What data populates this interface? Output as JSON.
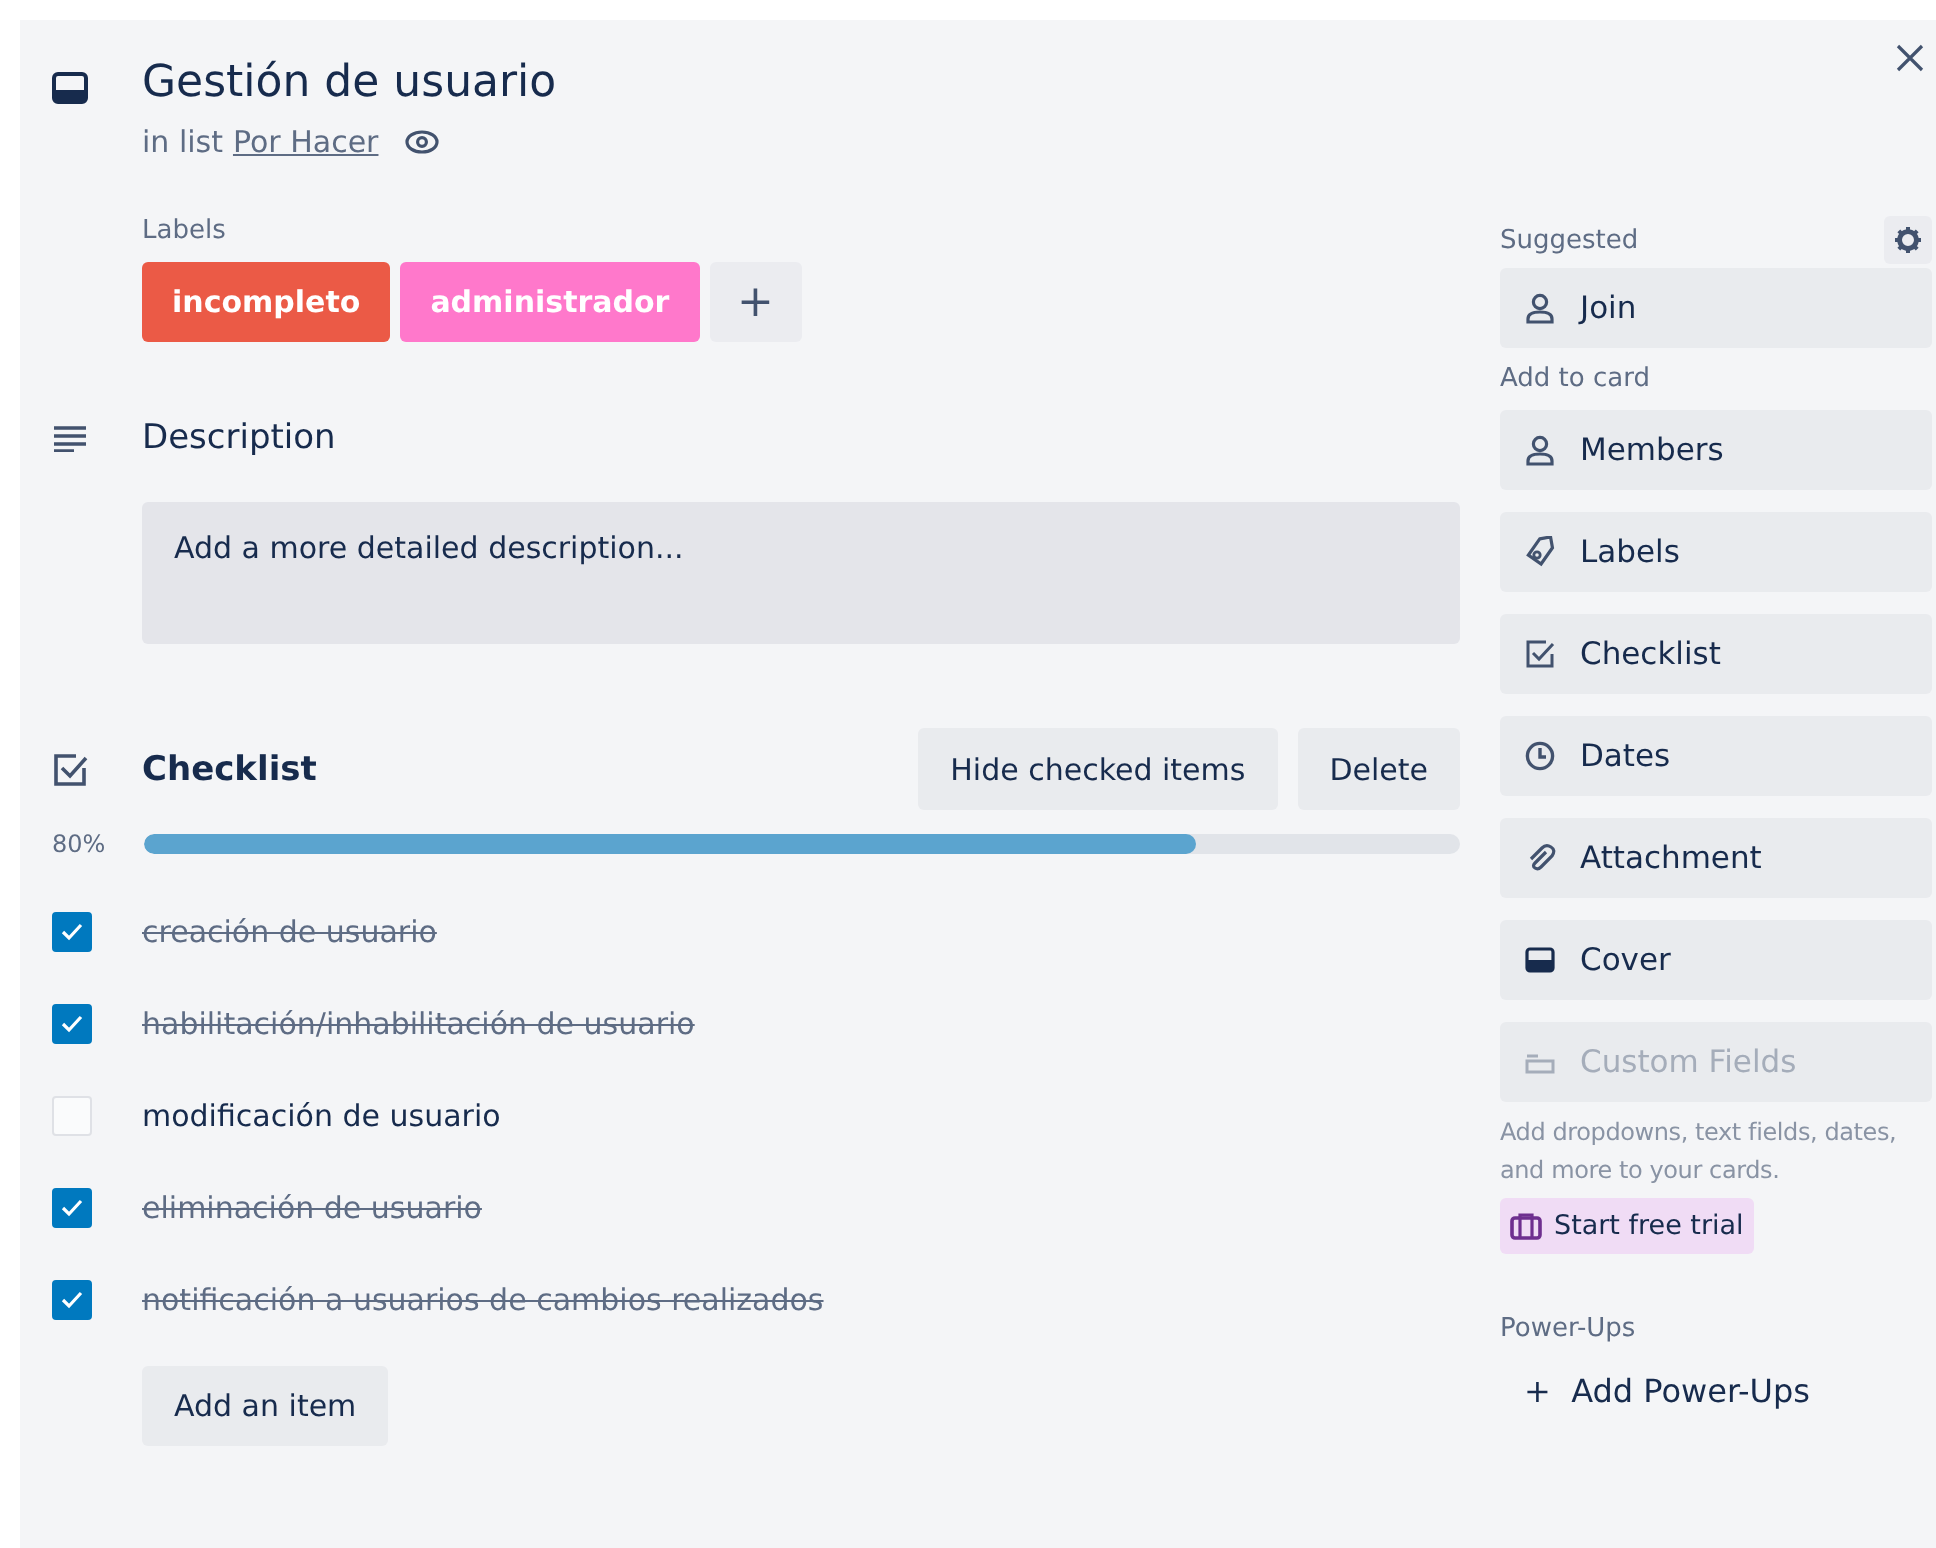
{
  "card": {
    "title": "Gestión de usuario",
    "list_prefix": "in list",
    "list_name": "Por Hacer"
  },
  "labels": {
    "heading": "Labels",
    "items": [
      {
        "text": "incompleto",
        "color": "#eb5a46"
      },
      {
        "text": "administrador",
        "color": "#ff78cb"
      }
    ],
    "add": "+"
  },
  "description": {
    "heading": "Description",
    "placeholder": "Add a more detailed description..."
  },
  "checklist": {
    "heading": "Checklist",
    "buttons": [
      "Hide checked items",
      "Delete"
    ],
    "percent": "80%",
    "level": 0.8,
    "items": [
      {
        "text": "creación de usuario",
        "checked": true
      },
      {
        "text": "habilitación/inhabilitación de usuario",
        "checked": true
      },
      {
        "text": "modificación de usuario",
        "checked": false
      },
      {
        "text": "eliminación de usuario",
        "checked": true
      },
      {
        "text": "notificación a usuarios de cambios realizados",
        "checked": true
      }
    ],
    "add_item": "Add an item"
  },
  "sidebar": {
    "suggested": {
      "heading": "Suggested",
      "items": [
        {
          "text": "Join",
          "disabled": false
        }
      ]
    },
    "add_to_card": {
      "heading": "Add to card",
      "items": [
        {
          "text": "Members",
          "disabled": false
        },
        {
          "text": "Labels",
          "disabled": false
        },
        {
          "text": "Checklist",
          "disabled": false
        },
        {
          "text": "Dates",
          "disabled": false
        },
        {
          "text": "Attachment",
          "disabled": false
        },
        {
          "text": "Cover",
          "disabled": false
        },
        {
          "text": "Custom Fields",
          "disabled": true
        }
      ]
    },
    "promo": "Add dropdowns, text fields, dates, and more to your cards.",
    "trial": "Start free trial",
    "power_ups": {
      "heading": "Power-Ups",
      "add": "Add Power-Ups",
      "add_icon": "+"
    }
  }
}
